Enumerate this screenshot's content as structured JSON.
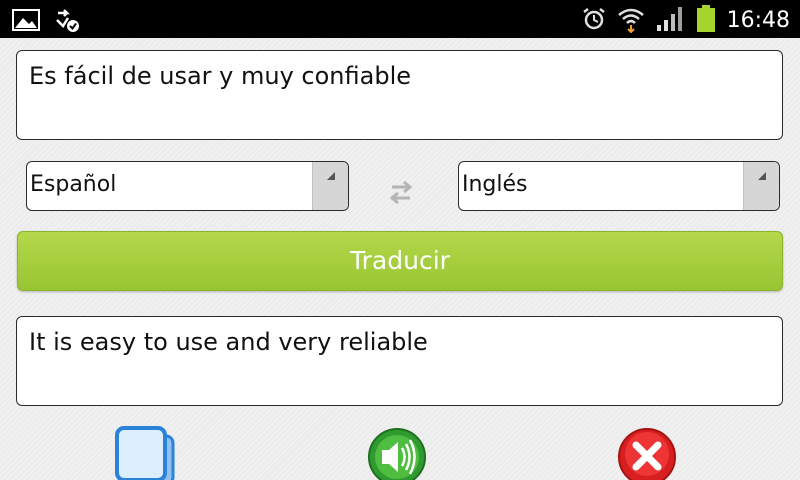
{
  "status_bar": {
    "time": "16:48",
    "icons": [
      "gallery-icon",
      "sync-icon",
      "alarm-icon",
      "wifi-icon",
      "signal-icon",
      "battery-icon"
    ]
  },
  "input": {
    "text": "Es fácil de usar y muy confiable"
  },
  "source_language": {
    "selected": "Español"
  },
  "target_language": {
    "selected": "Inglés"
  },
  "translate_button": {
    "label": "Traducir"
  },
  "output": {
    "text": "It is easy to use and very reliable"
  },
  "actions": [
    "copy-icon",
    "speaker-icon",
    "close-icon"
  ],
  "colors": {
    "accent_green": "#a3cf3e",
    "status_bar": "#000000",
    "battery": "#a6d42c"
  }
}
